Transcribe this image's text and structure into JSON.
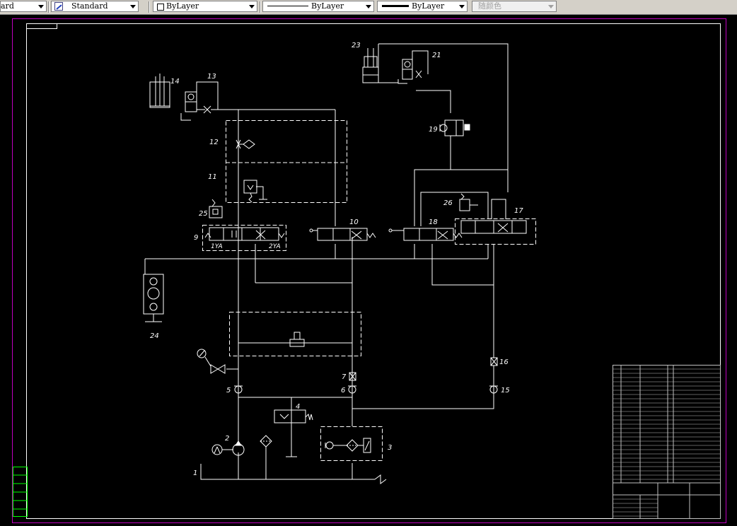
{
  "toolbar": {
    "text_style": "ard",
    "dim_style": "Standard",
    "layer_color": "ByLayer",
    "linetype": "ByLayer",
    "lineweight": "ByLayer",
    "plot_style": "随颜色"
  },
  "drawing": {
    "labels": {
      "n1": "1",
      "n2": "2",
      "n3": "3",
      "n4": "4",
      "n5": "5",
      "n6": "6",
      "n7": "7",
      "n9": "9",
      "n10": "10",
      "n11": "11",
      "n12": "12",
      "n13": "13",
      "n14": "14",
      "n15": "15",
      "n16": "16",
      "n17": "17",
      "n18": "18",
      "n19": "19",
      "n21": "21",
      "n23": "23",
      "n24": "24",
      "n25": "25",
      "n26": "26",
      "sol_1ya": "1YA",
      "sol_2ya": "2YA"
    },
    "colors": {
      "line": "#ffffff",
      "frame_outer": "#c000c0",
      "title_text": "#c0c0c0",
      "stamp": "#00ff00"
    }
  }
}
